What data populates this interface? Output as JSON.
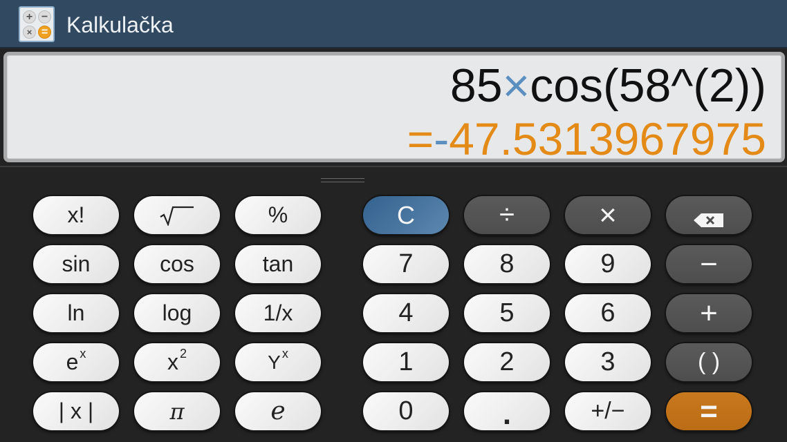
{
  "app": {
    "title": "Kalkulačka",
    "icon": "calculator-app-icon",
    "icon_glyphs": [
      "+",
      "−",
      "×",
      "="
    ]
  },
  "display": {
    "expression": {
      "part1": "85",
      "operator": "×",
      "part2": "cos(58^(2))"
    },
    "result": {
      "prefix": "=",
      "sign": "-",
      "value": "47.5313967975"
    }
  },
  "colors": {
    "titlebar": "#324a61",
    "display_bg": "#e7e8ea",
    "result_text": "#e38a17",
    "operator_text": "#5a8fbf",
    "clear_key": "#3f6d99",
    "equals_key": "#c2731a",
    "keypad_bg": "#232323"
  },
  "scientific_keys": [
    {
      "label": "x!",
      "name": "factorial"
    },
    {
      "label": "√‾",
      "name": "square-root"
    },
    {
      "label": "%",
      "name": "percent"
    },
    {
      "label": "sin",
      "name": "sin"
    },
    {
      "label": "cos",
      "name": "cos"
    },
    {
      "label": "tan",
      "name": "tan"
    },
    {
      "label": "ln",
      "name": "ln"
    },
    {
      "label": "log",
      "name": "log"
    },
    {
      "label": "1/x",
      "name": "reciprocal"
    },
    {
      "label": "e",
      "sup": "x",
      "name": "exp"
    },
    {
      "label": "x",
      "sup": "2",
      "name": "square"
    },
    {
      "label": "Y",
      "sup": "x",
      "name": "power"
    },
    {
      "label": "| x |",
      "name": "absolute"
    },
    {
      "label": "π",
      "name": "pi"
    },
    {
      "label": "e",
      "name": "euler"
    }
  ],
  "keypad": {
    "clear": "C",
    "divide": "÷",
    "multiply": "×",
    "backspace": "backspace-icon",
    "digits": [
      "7",
      "8",
      "9",
      "4",
      "5",
      "6",
      "1",
      "2",
      "3",
      "0"
    ],
    "minus": "−",
    "plus": "+",
    "parentheses": "( )",
    "decimal": ".",
    "sign": "+/−",
    "equals": "="
  }
}
